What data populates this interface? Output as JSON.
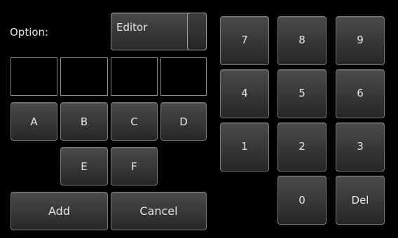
{
  "option": {
    "label": "Option:",
    "selected": "Editor"
  },
  "letters": [
    "A",
    "B",
    "C",
    "D",
    "E",
    "F"
  ],
  "actions": {
    "add": "Add",
    "cancel": "Cancel"
  },
  "keypad": [
    "7",
    "8",
    "9",
    "4",
    "5",
    "6",
    "1",
    "2",
    "3",
    "0",
    "Del"
  ]
}
